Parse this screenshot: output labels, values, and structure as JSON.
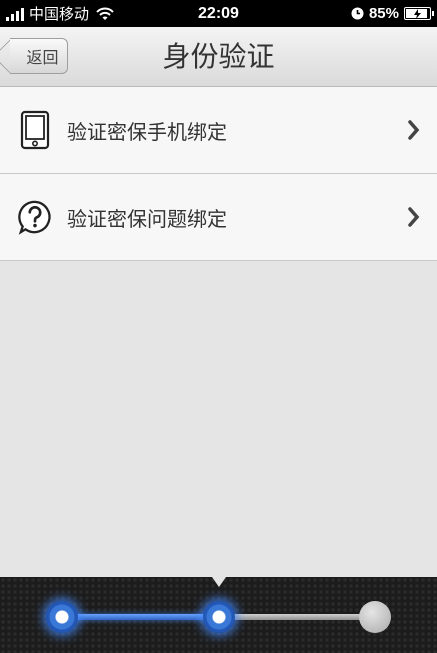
{
  "status_bar": {
    "carrier": "中国移动",
    "time": "22:09",
    "battery": "85%",
    "battery_level": 0.85
  },
  "nav": {
    "back_label": "返回",
    "title": "身份验证"
  },
  "menu": {
    "items": [
      {
        "label": "验证密保手机绑定",
        "icon": "phone-icon"
      },
      {
        "label": "验证密保问题绑定",
        "icon": "question-icon"
      }
    ]
  },
  "progress": {
    "steps_total": 3,
    "steps_completed": 2,
    "current_step": 2,
    "colors": {
      "active": "#3a78d8",
      "inactive": "#a9a9a9"
    }
  }
}
